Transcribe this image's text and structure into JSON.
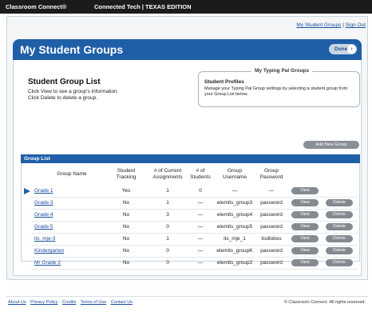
{
  "topbar": {
    "brand": "Classroom Connect®",
    "edition": "Connected Tech | TEXAS EDITION"
  },
  "links": {
    "my_groups": "My Student Groups",
    "separator": "|",
    "sign_out": "Sign Out"
  },
  "header": {
    "title": "My Student Groups",
    "done": "Done",
    "done_arrow": "›"
  },
  "intro": {
    "title": "Student Group List",
    "line1": "Click View to see a group's information.",
    "line2": "Click Delete to delete a group."
  },
  "typing_box": {
    "legend": "My Typing Pal Groups",
    "subtitle": "Student Profiles",
    "text": "Manage your Typing Pal Group settings by selecting a student group from your Group List below."
  },
  "add_group": "Add New Group",
  "group_list": {
    "title": "Group List",
    "headers": {
      "name": "Group Name",
      "tracking": "Student\nTracking",
      "assignments": "# of Current\nAssignments",
      "students": "# of\nStudents",
      "username": "Group\nUsername",
      "password": "Group\nPassword"
    },
    "view_label": "View",
    "delete_label": "Delete",
    "rows": [
      {
        "name": "Grade 1",
        "tracking": "Yes",
        "assignments": "1",
        "students": "0",
        "username": "—",
        "password": "—",
        "selected": true
      },
      {
        "name": "Grade 3",
        "tracking": "No",
        "assignments": "1",
        "students": "—",
        "username": "elemits_group3",
        "password": "password"
      },
      {
        "name": "Grade 4",
        "tracking": "No",
        "assignments": "3",
        "students": "—",
        "username": "elemits_group4",
        "password": "password"
      },
      {
        "name": "Grade 5",
        "tracking": "No",
        "assignments": "0",
        "students": "—",
        "username": "elemits_group5",
        "password": "password"
      },
      {
        "name": "its_mje-3",
        "tracking": "No",
        "assignments": "1",
        "students": "—",
        "username": "its_mje_1",
        "password": "lisdlobos"
      },
      {
        "name": "Kindergarten",
        "tracking": "No",
        "assignments": "0",
        "students": "—",
        "username": "elemits_groupK",
        "password": "password"
      },
      {
        "name": "Mr Grade 2",
        "tracking": "No",
        "assignments": "0",
        "students": "—",
        "username": "elemits_group2",
        "password": "password"
      }
    ]
  },
  "footer": {
    "links": [
      "About Us",
      "Privacy Policy",
      "Credits",
      "Terms of Use",
      "Contact Us"
    ],
    "copyright": "© Classroom Connect. All rights reserved."
  }
}
